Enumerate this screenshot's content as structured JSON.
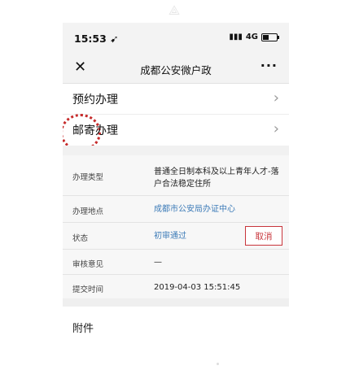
{
  "status_bar": {
    "time": "15:53",
    "signal": "4G"
  },
  "nav": {
    "title": "成都公安微户政",
    "close_glyph": "✕",
    "more_glyph": "···"
  },
  "menu": [
    {
      "label": "预约办理"
    },
    {
      "label": "邮寄办理"
    }
  ],
  "details": {
    "type_label": "办理类型",
    "type_value": "普通全日制本科及以上青年人才-落户合法稳定住所",
    "location_label": "办理地点",
    "location_value": "成都市公安局办证中心",
    "status_label": "状态",
    "status_value": "初审通过",
    "cancel_label": "取消",
    "review_label": "审核意见",
    "review_value": "—",
    "submit_label": "提交时间",
    "submit_value": "2019-04-03 15:51:45"
  },
  "attachments_label": "附件",
  "colors": {
    "link": "#3e7cb8",
    "cancel": "#c8353b",
    "highlight": "#c62b2b"
  }
}
